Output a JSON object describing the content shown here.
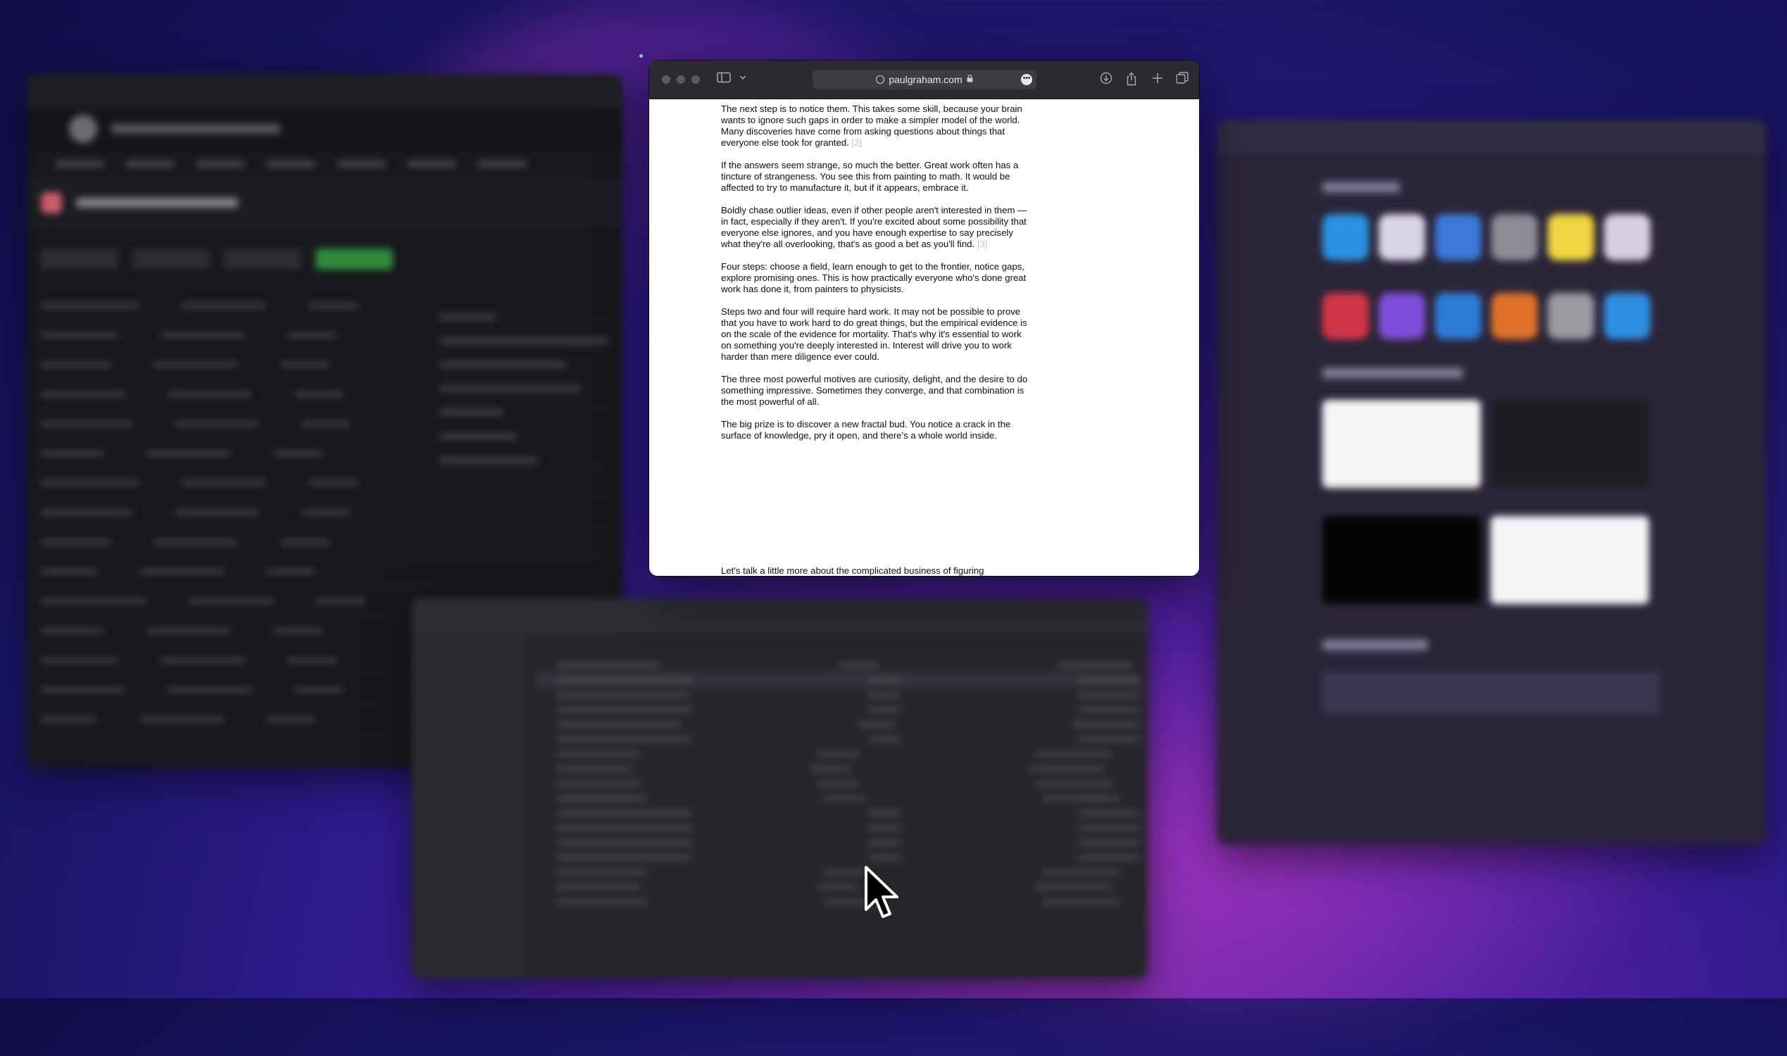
{
  "safari": {
    "url": "paulgraham.com",
    "toolbar_icons": {
      "sidebar": "sidebar-icon",
      "tab_group_chevron": "chevron-down-icon",
      "download": "download-icon",
      "share": "share-icon",
      "new_tab": "plus-icon",
      "tab_overview": "tab-overview-icon",
      "lock": "lock-icon",
      "more": "ellipsis-icon"
    }
  },
  "article": {
    "p1": "The next step is to notice them. This takes some skill, because your brain wants to ignore such gaps in order to make a simpler model of the world. Many discoveries have come from asking questions about things that everyone else took for granted.",
    "p1_note": "[2]",
    "p2": "If the answers seem strange, so much the better. Great work often has a tincture of strangeness. You see this from painting to math. It would be affected to try to manufacture it, but if it appears, embrace it.",
    "p3": "Boldly chase outlier ideas, even if other people aren't interested in them — in fact, especially if they aren't. If you're excited about some possibility that everyone else ignores, and you have enough expertise to say precisely what they're all overlooking, that's as good a bet as you'll find.",
    "p3_note": "[3]",
    "p4": "Four steps: choose a field, learn enough to get to the frontier, notice gaps, explore promising ones. This is how practically everyone who's done great work has done it, from painters to physicists.",
    "p5": "Steps two and four will require hard work. It may not be possible to prove that you have to work hard to do great things, but the empirical evidence is on the scale of the evidence for mortality. That's why it's essential to work on something you're deeply interested in. Interest will drive you to work harder than mere diligence ever could.",
    "p6": "The three most powerful motives are curiosity, delight, and the desire to do something impressive. Sometimes they converge, and that combination is the most powerful of all.",
    "p7": "The big prize is to discover a new fractal bud. You notice a crack in the surface of knowledge, pry it open, and there's a whole world inside.",
    "next": "Let's talk a little more about the complicated business of figuring"
  },
  "desktop": {
    "cursor": "pointer-cursor-icon"
  }
}
